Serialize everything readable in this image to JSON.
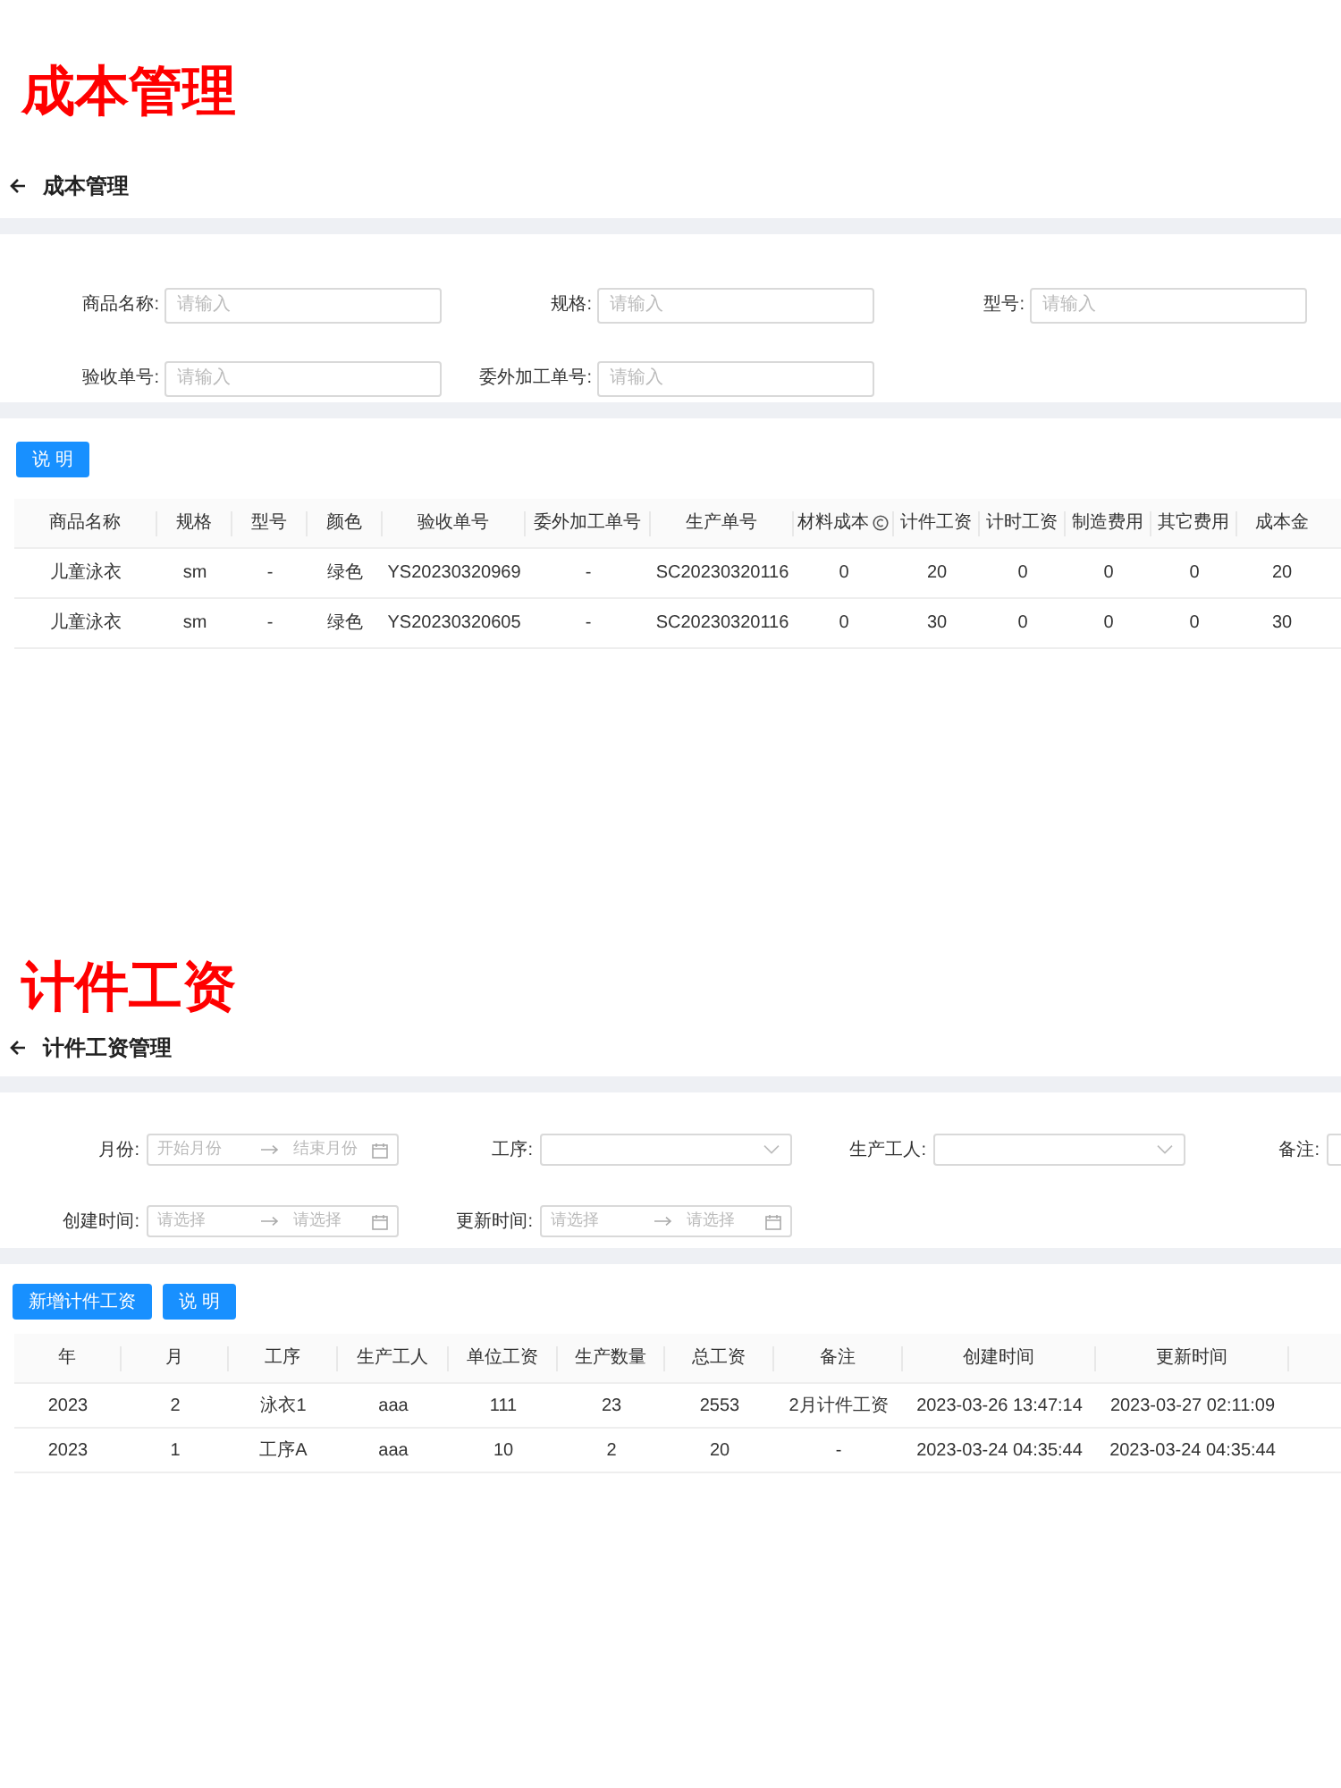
{
  "cost_section": {
    "heading": "成本管理",
    "page_title": "成本管理",
    "filters": [
      {
        "label": "商品名称:",
        "placeholder": "请输入"
      },
      {
        "label": "规格:",
        "placeholder": "请输入"
      },
      {
        "label": "型号:",
        "placeholder": "请输入"
      },
      {
        "label": "验收单号:",
        "placeholder": "请输入"
      },
      {
        "label": "委外加工单号:",
        "placeholder": "请输入"
      }
    ],
    "buttons": [
      "说 明"
    ],
    "table": {
      "columns": [
        {
          "label": "商品名称",
          "has_info": false
        },
        {
          "label": "规格",
          "has_info": false
        },
        {
          "label": "型号",
          "has_info": false
        },
        {
          "label": "颜色",
          "has_info": false
        },
        {
          "label": "验收单号",
          "has_info": false
        },
        {
          "label": "委外加工单号",
          "has_info": false
        },
        {
          "label": "生产单号",
          "has_info": false
        },
        {
          "label": "材料成本",
          "has_info": true
        },
        {
          "label": "计件工资",
          "has_info": false
        },
        {
          "label": "计时工资",
          "has_info": false
        },
        {
          "label": "制造费用",
          "has_info": false
        },
        {
          "label": "其它费用",
          "has_info": false
        },
        {
          "label": "成本金",
          "has_info": false
        }
      ],
      "rows": [
        [
          "儿童泳衣",
          "sm",
          "-",
          "绿色",
          "YS20230320969",
          "-",
          "SC20230320116",
          "0",
          "20",
          "0",
          "0",
          "0",
          "20"
        ],
        [
          "儿童泳衣",
          "sm",
          "-",
          "绿色",
          "YS20230320605",
          "-",
          "SC20230320116",
          "0",
          "30",
          "0",
          "0",
          "0",
          "30"
        ]
      ]
    }
  },
  "wage_section": {
    "heading": "计件工资",
    "page_title": "计件工资管理",
    "filters": [
      {
        "kind": "range",
        "label": "月份:",
        "start_placeholder": "开始月份",
        "end_placeholder": "结束月份"
      },
      {
        "kind": "select",
        "label": "工序:"
      },
      {
        "kind": "select",
        "label": "生产工人:"
      },
      {
        "kind": "input",
        "label": "备注:"
      },
      {
        "kind": "range",
        "label": "创建时间:",
        "start_placeholder": "请选择",
        "end_placeholder": "请选择"
      },
      {
        "kind": "range",
        "label": "更新时间:",
        "start_placeholder": "请选择",
        "end_placeholder": "请选择"
      }
    ],
    "buttons": [
      "新增计件工资",
      "说 明"
    ],
    "table": {
      "columns": [
        "年",
        "月",
        "工序",
        "生产工人",
        "单位工资",
        "生产数量",
        "总工资",
        "备注",
        "创建时间",
        "更新时间"
      ],
      "rows": [
        [
          "2023",
          "2",
          "泳衣1",
          "aaa",
          "111",
          "23",
          "2553",
          "2月计件工资",
          "2023-03-26 13:47:14",
          "2023-03-27 02:11:09"
        ],
        [
          "2023",
          "1",
          "工序A",
          "aaa",
          "10",
          "2",
          "20",
          "-",
          "2023-03-24 04:35:44",
          "2023-03-24 04:35:44"
        ]
      ]
    }
  }
}
